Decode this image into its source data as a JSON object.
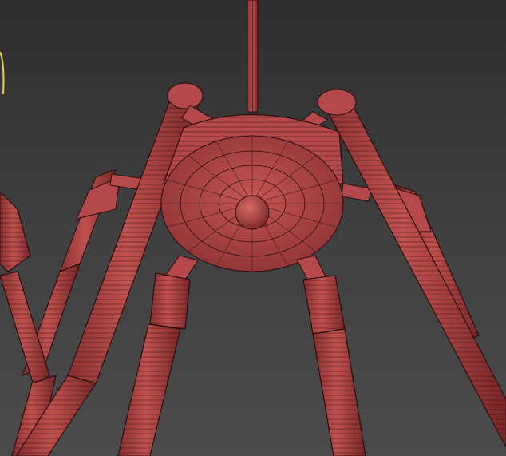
{
  "viewport": {
    "background_color": "#3a3a3a",
    "mesh_color": "#b5484a",
    "wire_color": "#2a0d0d",
    "selection_color": "#e0d34a",
    "display_mode": "wireframe-on-shaded"
  },
  "scene": {
    "object": "chandelier",
    "parts": [
      "ceiling-rod",
      "central-hub",
      "center-finial",
      "arm",
      "arm-joint"
    ]
  }
}
